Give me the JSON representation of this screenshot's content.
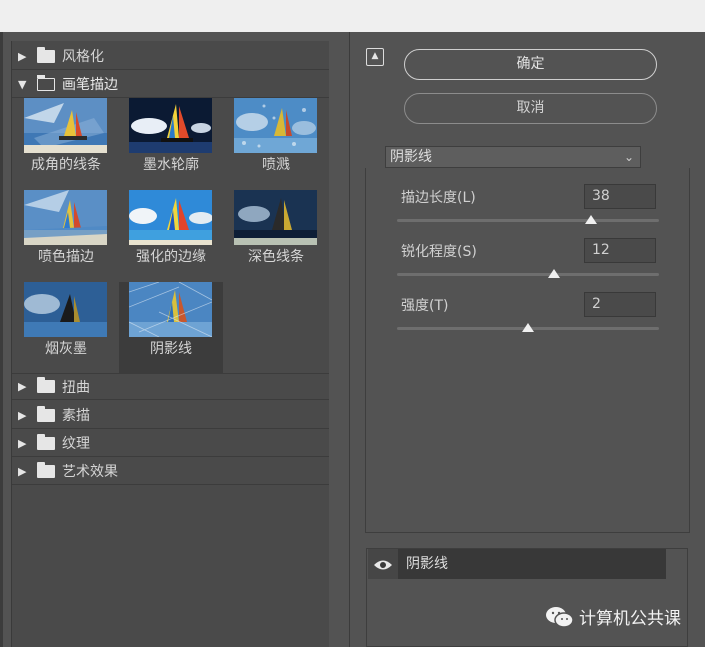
{
  "categories_top": [
    {
      "label": "风格化",
      "state": "collapsed"
    },
    {
      "label": "画笔描边",
      "state": "expanded"
    }
  ],
  "filters": [
    {
      "label": "成角的线条",
      "selected": false
    },
    {
      "label": "墨水轮廓",
      "selected": false
    },
    {
      "label": "喷溅",
      "selected": false
    },
    {
      "label": "喷色描边",
      "selected": false
    },
    {
      "label": "强化的边缘",
      "selected": false
    },
    {
      "label": "深色线条",
      "selected": false
    },
    {
      "label": "烟灰墨",
      "selected": false
    },
    {
      "label": "阴影线",
      "selected": true
    }
  ],
  "categories_bottom": [
    {
      "label": "扭曲"
    },
    {
      "label": "素描"
    },
    {
      "label": "纹理"
    },
    {
      "label": "艺术效果"
    }
  ],
  "buttons": {
    "ok": "确定",
    "cancel": "取消"
  },
  "filter_select": {
    "value": "阴影线"
  },
  "params": [
    {
      "label": "描边长度(L)",
      "value": "38",
      "slider_fraction": 0.74
    },
    {
      "label": "锐化程度(S)",
      "value": "12",
      "slider_fraction": 0.6
    },
    {
      "label": "强度(T)",
      "value": "2",
      "slider_fraction": 0.5
    }
  ],
  "layer": {
    "label": "阴影线"
  },
  "watermark": {
    "text": "计算机公共课"
  },
  "icons": {
    "expand": "collapse-panel-icon",
    "arrow_right": "▶",
    "arrow_down": "▼",
    "chevron": "⌄"
  },
  "colors": {
    "panel": "#535353",
    "tree_bg": "#4a4a4a",
    "selected": "#3c3c3c",
    "text": "#d8d8d8"
  }
}
